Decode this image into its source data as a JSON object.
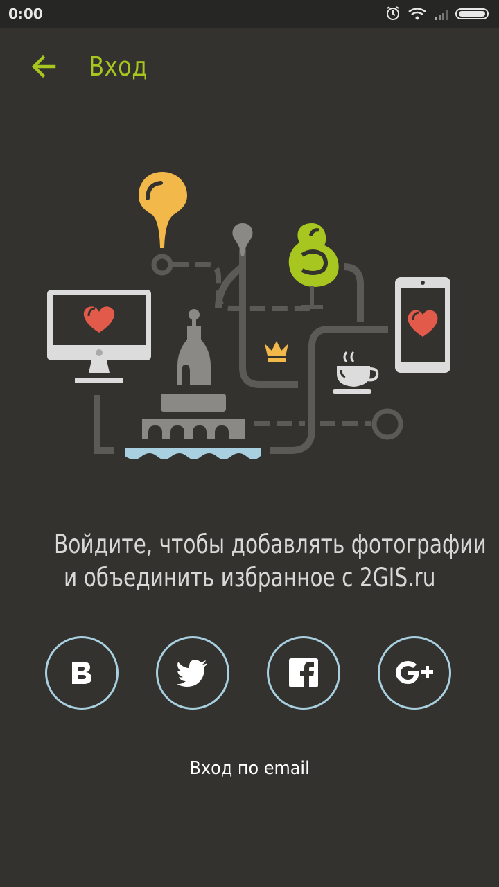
{
  "status_bar": {
    "time": "0:00",
    "icons": [
      "alarm-icon",
      "wifi-icon",
      "signal-icon",
      "battery-icon"
    ]
  },
  "header": {
    "back_icon": "arrow-left-icon",
    "title": "Вход"
  },
  "message": {
    "line1": "Войдите, чтобы добавлять фотографии",
    "line2": "и объединить избранное с 2GIS.ru"
  },
  "social_buttons": [
    {
      "name": "vk",
      "icon": "vk-icon"
    },
    {
      "name": "twitter",
      "icon": "twitter-icon"
    },
    {
      "name": "facebook",
      "icon": "facebook-icon"
    },
    {
      "name": "google-plus",
      "icon": "google-plus-icon"
    }
  ],
  "email_login": "Вход по email",
  "colors": {
    "background": "#33322e",
    "accent": "#a7c61f",
    "circle_border": "#a8d0e0",
    "heart": "#e25a4a",
    "pin_yellow": "#f2b84a"
  }
}
